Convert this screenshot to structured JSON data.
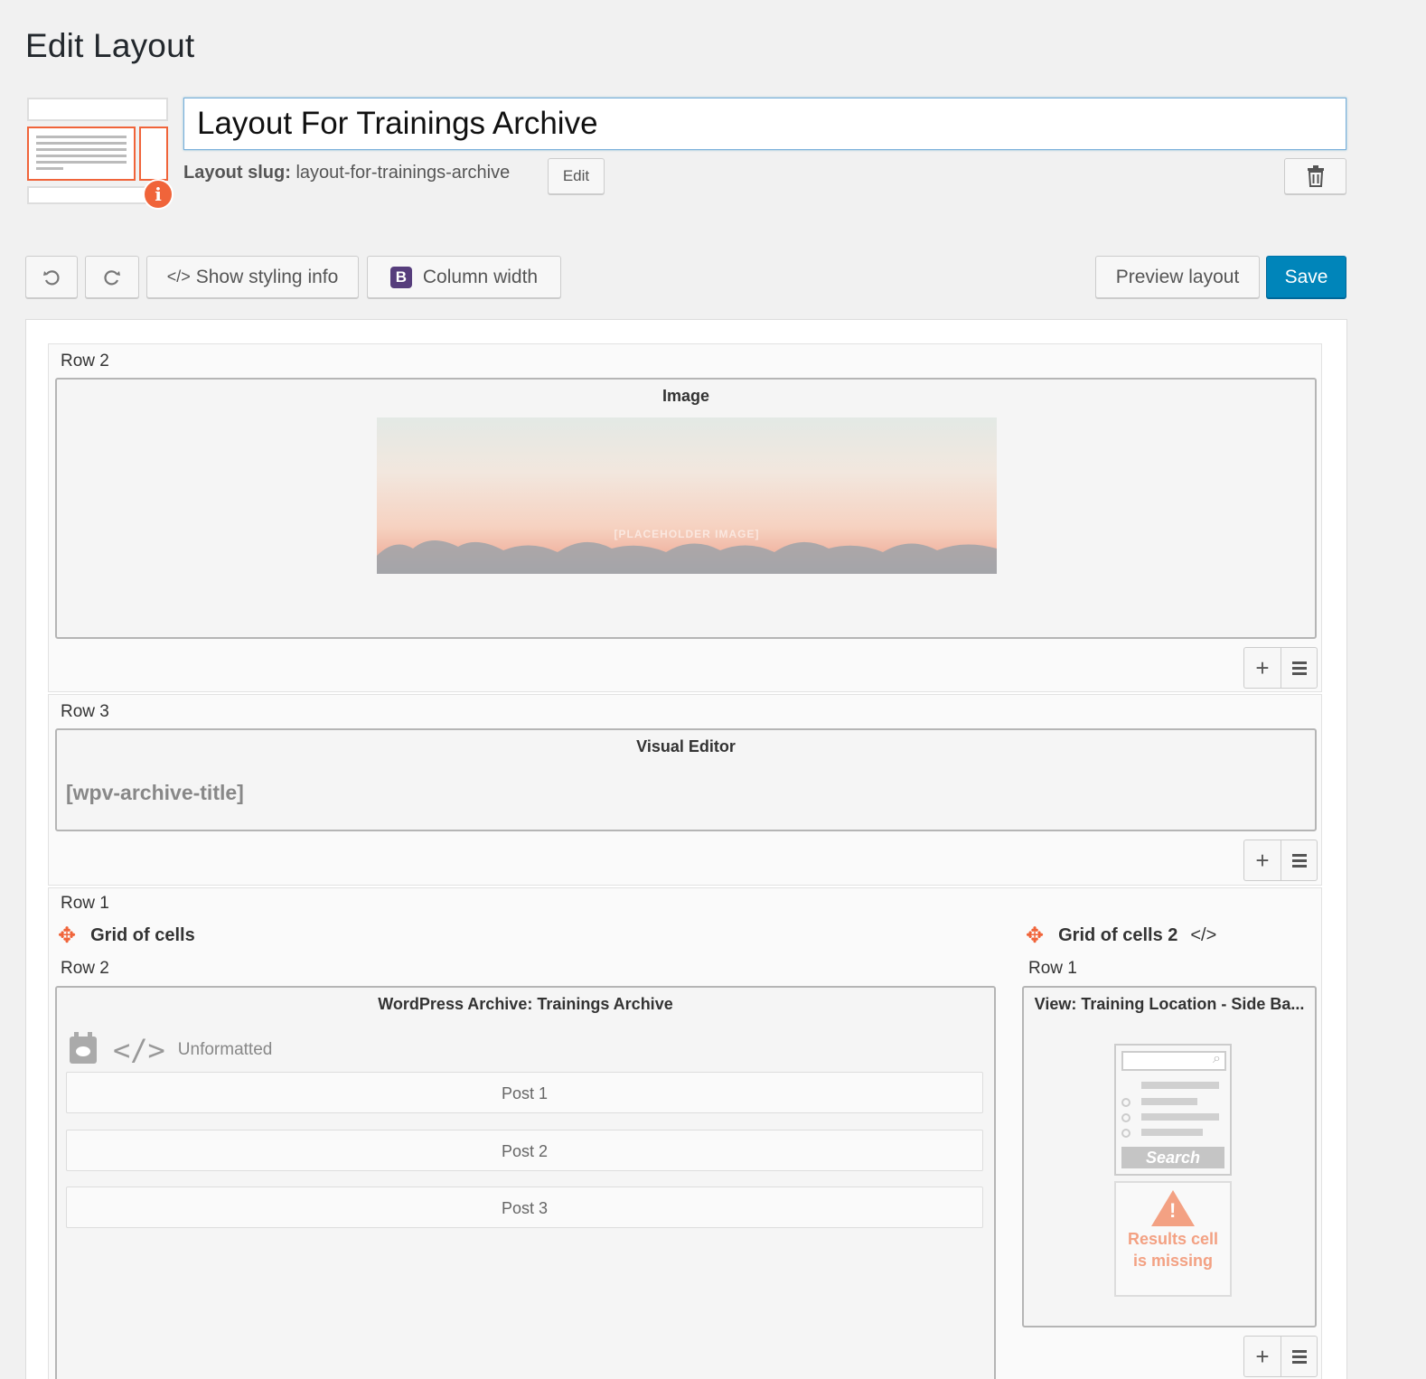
{
  "page": {
    "title": "Edit Layout"
  },
  "layout": {
    "name": "Layout For Trainings Archive",
    "slug_label": "Layout slug:",
    "slug_value": "layout-for-trainings-archive",
    "slug_edit": "Edit"
  },
  "toolbar": {
    "styling_info": "Show styling info",
    "column_width": "Column width",
    "bootstrap_letter": "B",
    "preview": "Preview layout",
    "save": "Save"
  },
  "rows": [
    {
      "label": "Row 2",
      "cell_title": "Image",
      "image_caption": "[PLACEHOLDER IMAGE]"
    },
    {
      "label": "Row 3",
      "cell_title": "Visual Editor",
      "shortcode": "[wpv-archive-title]"
    },
    {
      "label": "Row 1",
      "grid_left": {
        "title": "Grid of cells",
        "row_label": "Row 2",
        "cell_title": "WordPress Archive: Trainings Archive",
        "format": "Unformatted",
        "posts": [
          "Post 1",
          "Post 2",
          "Post 3"
        ]
      },
      "grid_right": {
        "title": "Grid of cells 2",
        "row_label": "Row 1",
        "cell_title": "View: Training Location - Side Ba...",
        "search_label": "Search",
        "missing_line1": "Results cell",
        "missing_line2": "is missing"
      }
    }
  ],
  "icons": {
    "info": "i",
    "plus": "+",
    "code": "</>"
  },
  "colors": {
    "accent": "#f0643a",
    "primary": "#0085ba",
    "bootstrap": "#563d7c"
  }
}
